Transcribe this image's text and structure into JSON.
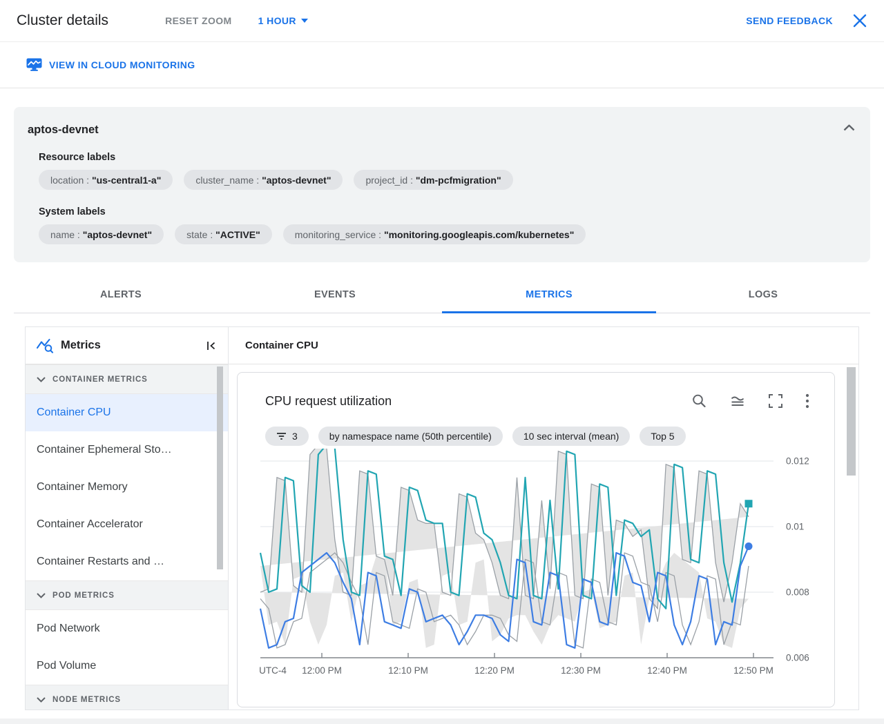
{
  "strings": {
    "separator": " : "
  },
  "colors": {
    "accent": "#1A73E8",
    "series_teal": "#21A5B2",
    "series_blue": "#3D7DE3",
    "band_fill": "#E4E4E4",
    "band_edge": "#9AA0A6",
    "grid": "#E8EAED",
    "axis": "#80868B",
    "chip_bg": "#E4E6E9",
    "card_bg": "#F1F3F4",
    "selected_bg": "#E8F0FE"
  },
  "header": {
    "title": "Cluster details",
    "reset_zoom": "RESET ZOOM",
    "time_range": "1 HOUR",
    "send_feedback": "SEND FEEDBACK"
  },
  "monitoring_link": {
    "label": "VIEW IN CLOUD MONITORING"
  },
  "cluster_card": {
    "name": "aptos-devnet",
    "resource_labels_title": "Resource labels",
    "resource_labels": [
      {
        "key": "location",
        "value": "\"us-central1-a\""
      },
      {
        "key": "cluster_name",
        "value": "\"aptos-devnet\""
      },
      {
        "key": "project_id",
        "value": "\"dm-pcfmigration\""
      }
    ],
    "system_labels_title": "System labels",
    "system_labels": [
      {
        "key": "name",
        "value": "\"aptos-devnet\""
      },
      {
        "key": "state",
        "value": "\"ACTIVE\""
      },
      {
        "key": "monitoring_service",
        "value": "\"monitoring.googleapis.com/kubernetes\""
      }
    ]
  },
  "tabs": [
    {
      "label": "ALERTS"
    },
    {
      "label": "EVENTS"
    },
    {
      "label": "METRICS",
      "active": true
    },
    {
      "label": "LOGS"
    }
  ],
  "sidebar": {
    "title": "Metrics",
    "sections": [
      {
        "label": "CONTAINER METRICS",
        "items": [
          {
            "label": "Container CPU",
            "selected": true
          },
          {
            "label": "Container Ephemeral Sto…"
          },
          {
            "label": "Container Memory"
          },
          {
            "label": "Container Accelerator"
          },
          {
            "label": "Container Restarts and …"
          }
        ]
      },
      {
        "label": "POD METRICS",
        "items": [
          {
            "label": "Pod Network"
          },
          {
            "label": "Pod Volume"
          }
        ]
      },
      {
        "label": "NODE METRICS",
        "items": []
      }
    ]
  },
  "main": {
    "panel_title": "Container CPU",
    "chart_title": "CPU request utilization",
    "chips": [
      {
        "icon": "filter-icon",
        "label": "3"
      },
      {
        "label": "by namespace name (50th percentile)"
      },
      {
        "label": "10 sec interval (mean)"
      },
      {
        "label": "Top 5"
      }
    ]
  },
  "chart_data": {
    "type": "line",
    "title": "CPU request utilization",
    "timezone_label": "UTC-4",
    "x_tick_labels": [
      "12:00 PM",
      "12:10 PM",
      "12:20 PM",
      "12:30 PM",
      "12:40 PM",
      "12:50 PM"
    ],
    "y_ticks": [
      0.006,
      0.008,
      0.01,
      0.012
    ],
    "ylim": [
      0.006,
      0.0126
    ],
    "grid": true,
    "legend": "none",
    "series": [
      {
        "name": "gray-band-upper",
        "role": "band-upper",
        "color": "#9AA0A6",
        "values": [
          0.008,
          0.0081,
          0.0115,
          0.0114,
          0.0082,
          0.008,
          0.0122,
          0.0125,
          0.0124,
          0.0096,
          0.008,
          0.0079,
          0.0117,
          0.0116,
          0.0091,
          0.009,
          0.0079,
          0.0112,
          0.0111,
          0.0102,
          0.0101,
          0.0101,
          0.008,
          0.0079,
          0.011,
          0.0109,
          0.0098,
          0.0096,
          0.0089,
          0.0079,
          0.0078,
          0.0115,
          0.0079,
          0.0078,
          0.0108,
          0.0081,
          0.0123,
          0.0122,
          0.0079,
          0.0078,
          0.0113,
          0.0112,
          0.0079,
          0.0102,
          0.0101,
          0.0097,
          0.0099,
          0.0078,
          0.0075,
          0.0119,
          0.0118,
          0.009,
          0.0089,
          0.0117,
          0.0116,
          0.0089,
          0.0077,
          0.0089,
          0.0107,
          0.0103
        ]
      },
      {
        "name": "gray-band-lower",
        "role": "band-lower",
        "color": "#9AA0A6",
        "values": [
          0.0078,
          0.0075,
          0.0063,
          0.0064,
          0.0071,
          0.0072,
          0.0086,
          0.0088,
          0.009,
          0.0092,
          0.0089,
          0.0083,
          0.0078,
          0.0064,
          0.0086,
          0.0085,
          0.0071,
          0.007,
          0.0069,
          0.0081,
          0.008,
          0.0071,
          0.0072,
          0.0073,
          0.007,
          0.0064,
          0.0068,
          0.0073,
          0.0073,
          0.0072,
          0.0067,
          0.0065,
          0.009,
          0.0089,
          0.0071,
          0.007,
          0.0086,
          0.0085,
          0.0064,
          0.0063,
          0.0084,
          0.0083,
          0.0071,
          0.007,
          0.0092,
          0.0091,
          0.0083,
          0.0082,
          0.0071,
          0.0086,
          0.0085,
          0.007,
          0.0064,
          0.0071,
          0.0085,
          0.0084,
          0.0064,
          0.0071,
          0.007,
          0.0088
        ]
      },
      {
        "name": "teal-namespace-50th-percentile",
        "role": "line",
        "color": "#21A5B2",
        "marker": "square",
        "values": [
          0.0092,
          0.008,
          0.0081,
          0.0115,
          0.0114,
          0.0082,
          0.008,
          0.0122,
          0.0125,
          0.0124,
          0.0096,
          0.008,
          0.0079,
          0.0117,
          0.0116,
          0.0091,
          0.009,
          0.0079,
          0.0112,
          0.0111,
          0.0102,
          0.0101,
          0.0101,
          0.008,
          0.0079,
          0.011,
          0.0109,
          0.0098,
          0.0096,
          0.0089,
          0.0079,
          0.0078,
          0.0115,
          0.0079,
          0.0078,
          0.0108,
          0.0081,
          0.0123,
          0.0122,
          0.0079,
          0.0078,
          0.0113,
          0.0112,
          0.0079,
          0.0102,
          0.0101,
          0.0097,
          0.0099,
          0.0078,
          0.0075,
          0.0119,
          0.0118,
          0.009,
          0.0089,
          0.0117,
          0.0116,
          0.0089,
          0.0077,
          0.0089,
          0.0107
        ]
      },
      {
        "name": "blue-namespace-50th-percentile",
        "role": "line",
        "color": "#3D7DE3",
        "marker": "circle",
        "values": [
          0.0075,
          0.0063,
          0.0064,
          0.0071,
          0.0072,
          0.0086,
          0.0088,
          0.009,
          0.0092,
          0.0089,
          0.0083,
          0.0078,
          0.0064,
          0.0086,
          0.0085,
          0.0071,
          0.007,
          0.0069,
          0.0081,
          0.008,
          0.0071,
          0.0072,
          0.0073,
          0.007,
          0.0064,
          0.0068,
          0.0073,
          0.0073,
          0.0072,
          0.0067,
          0.0065,
          0.009,
          0.0089,
          0.0071,
          0.007,
          0.0086,
          0.0085,
          0.0064,
          0.0063,
          0.0084,
          0.0083,
          0.0071,
          0.007,
          0.0092,
          0.0091,
          0.0083,
          0.0082,
          0.0071,
          0.0086,
          0.0085,
          0.007,
          0.0064,
          0.0071,
          0.0085,
          0.0084,
          0.0064,
          0.0071,
          0.007,
          0.0088,
          0.0094
        ]
      }
    ]
  }
}
